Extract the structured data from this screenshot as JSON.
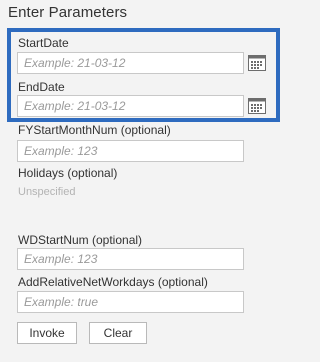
{
  "dialog": {
    "title": "Enter Parameters"
  },
  "params": {
    "start_date": {
      "label": "StartDate",
      "placeholder": "Example: 21-03-12",
      "icon": "calendar-icon"
    },
    "end_date": {
      "label": "EndDate",
      "placeholder": "Example: 21-03-12",
      "icon": "calendar-icon"
    },
    "fy_start_month": {
      "label": "FYStartMonthNum (optional)",
      "placeholder": "Example: 123"
    },
    "holidays": {
      "label": "Holidays (optional)",
      "value": "Unspecified"
    },
    "wd_start_num": {
      "label": "WDStartNum (optional)",
      "placeholder": "Example: 123"
    },
    "add_relative_net_workdays": {
      "label": "AddRelativeNetWorkdays (optional)",
      "placeholder": "Example: true"
    }
  },
  "buttons": {
    "invoke": "Invoke",
    "clear": "Clear"
  },
  "colors": {
    "highlight_border": "#2e6bbf",
    "background": "#f3f3f3"
  }
}
